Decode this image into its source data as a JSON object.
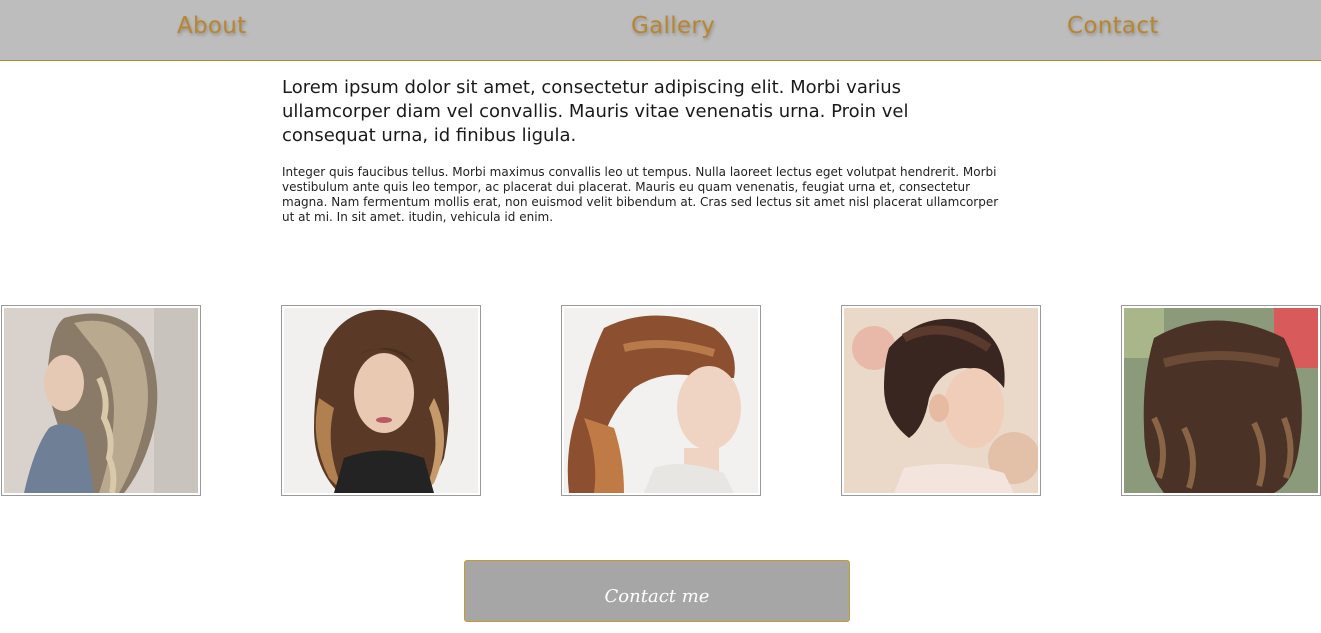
{
  "nav": {
    "about": "About",
    "gallery": "Gallery",
    "contact": "Contact"
  },
  "intro": {
    "lead": "Lorem ipsum dolor sit amet, consectetur adipiscing elit. Morbi varius ullamcorper diam vel convallis. Mauris vitae venenatis urna. Proin vel consequat urna, id finibus ligula.",
    "body": "Integer quis faucibus tellus. Morbi maximus convallis leo ut tempus. Nulla laoreet lectus eget volutpat hendrerit. Morbi vestibulum ante quis leo tempor, ac placerat dui placerat. Mauris eu quam venenatis, feugiat urna et, consectetur magna. Nam fermentum mollis erat, non euismod velit bibendum at. Cras sed lectus sit amet nisl placerat ullamcorper ut at mi. In sit amet. itudin, vehicula id enim."
  },
  "cta": {
    "label": "Contact me"
  },
  "colors": {
    "nav_bg": "#bdbdbd",
    "nav_text": "#b8862f",
    "cta_bg": "#a6a6a6",
    "cta_border": "#c79a2e"
  }
}
